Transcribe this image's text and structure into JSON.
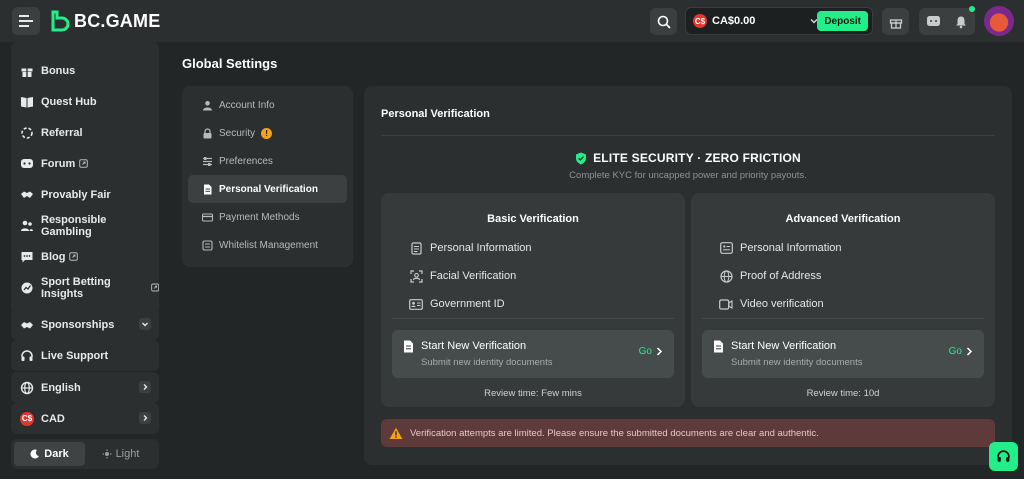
{
  "header": {
    "logo_text": "BC.GAME",
    "currency_code": "C$",
    "balance": "CA$0.00",
    "deposit_label": "Deposit"
  },
  "sidebar": {
    "items": [
      {
        "label": "Bonus",
        "icon": "gift-icon"
      },
      {
        "label": "Quest Hub",
        "icon": "book-icon"
      },
      {
        "label": "Referral",
        "icon": "referral-icon"
      },
      {
        "label": "Forum",
        "icon": "forum-icon",
        "external": true
      },
      {
        "label": "Provably Fair",
        "icon": "handshake-icon"
      },
      {
        "label": "Responsible Gambling",
        "icon": "people-icon"
      },
      {
        "label": "Blog",
        "icon": "chat-icon",
        "external": true
      },
      {
        "label": "Sport Betting Insights",
        "icon": "chart-icon",
        "external": true
      }
    ],
    "sponsorships": "Sponsorships",
    "live_support": "Live Support",
    "language": "English",
    "currency": "CAD",
    "currency_badge": "C$",
    "theme": {
      "dark": "Dark",
      "light": "Light",
      "active": "dark"
    }
  },
  "page": {
    "title": "Global Settings"
  },
  "settings_nav": {
    "items": [
      {
        "label": "Account Info",
        "icon": "user-icon"
      },
      {
        "label": "Security",
        "icon": "lock-icon",
        "warning": "!"
      },
      {
        "label": "Preferences",
        "icon": "sliders-icon"
      },
      {
        "label": "Personal Verification",
        "icon": "document-icon",
        "active": true
      },
      {
        "label": "Payment Methods",
        "icon": "card-icon"
      },
      {
        "label": "Whitelist Management",
        "icon": "list-icon"
      }
    ]
  },
  "verification": {
    "title": "Personal Verification",
    "headline": "ELITE SECURITY · ZERO FRICTION",
    "subheadline": "Complete KYC for uncapped power and priority payouts.",
    "basic": {
      "title": "Basic Verification",
      "requirements": [
        "Personal Information",
        "Facial Verification",
        "Government ID"
      ],
      "start_title": "Start New Verification",
      "start_sub": "Submit new identity documents",
      "go": "Go",
      "review": "Review time: Few mins"
    },
    "advanced": {
      "title": "Advanced Verification",
      "requirements": [
        "Personal Information",
        "Proof of Address",
        "Video verification"
      ],
      "start_title": "Start New Verification",
      "start_sub": "Submit new identity documents",
      "go": "Go",
      "review": "Review time: 10d"
    },
    "alert": "Verification attempts are limited. Please ensure the submitted documents are clear and authentic."
  },
  "colors": {
    "accent": "#24ee89",
    "background": "#232626",
    "panel": "#2c2f30",
    "warning": "#f3a21a",
    "alert_bg": "#5e3a3a"
  }
}
